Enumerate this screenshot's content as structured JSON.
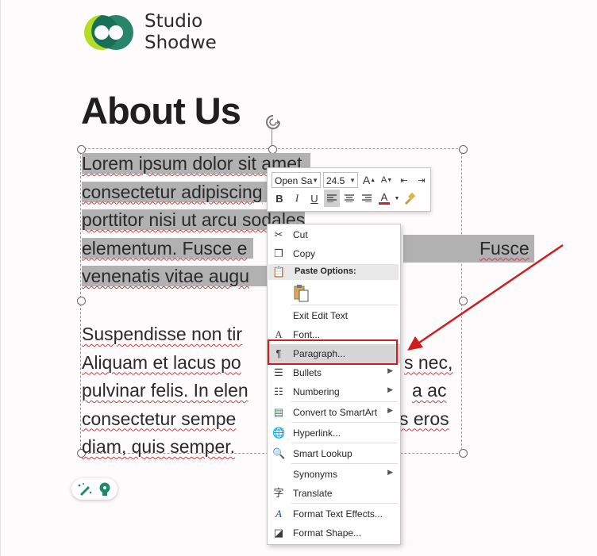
{
  "brand": {
    "line1": "Studio",
    "line2": "Shodwe"
  },
  "slide_title": "About Us",
  "paragraph1": [
    "Lorem ipsum dolor sit amet,",
    "consectetur adipiscing",
    "porttitor nisi ut arcu sodales",
    "elementum. Fusce e",
    "venenatis vitae augu"
  ],
  "paragraph1_right": [
    "",
    "",
    "",
    "Fusce",
    ""
  ],
  "paragraph2": [
    {
      "left": "Suspendisse non tir",
      "right": ""
    },
    {
      "left": "Aliquam et lacus po",
      "right": "s nec,"
    },
    {
      "left": "pulvinar felis. In elen",
      "right": "a ac"
    },
    {
      "left": "consectetur sempe",
      "right": "s eros"
    },
    {
      "left": "diam, quis semper.",
      "right": ""
    }
  ],
  "mini_toolbar": {
    "font_name": "Open Sa",
    "font_size": "24.5",
    "bold": "B",
    "italic": "I",
    "underline": "U",
    "font_color_letter": "A",
    "font_color": "#d02020"
  },
  "context_menu": {
    "cut": "Cut",
    "copy": "Copy",
    "paste_options": "Paste Options:",
    "exit_edit_text": "Exit Edit Text",
    "font": "Font...",
    "paragraph": "Paragraph...",
    "bullets": "Bullets",
    "numbering": "Numbering",
    "convert_to_smartart": "Convert to SmartArt",
    "hyperlink": "Hyperlink...",
    "smart_lookup": "Smart Lookup",
    "synonyms": "Synonyms",
    "translate": "Translate",
    "format_text_effects": "Format Text Effects...",
    "format_shape": "Format Shape..."
  },
  "colors": {
    "highlight_box": "#cf1c1c",
    "logo_green": "#a6d22e",
    "logo_teal": "#1f7a5e"
  }
}
